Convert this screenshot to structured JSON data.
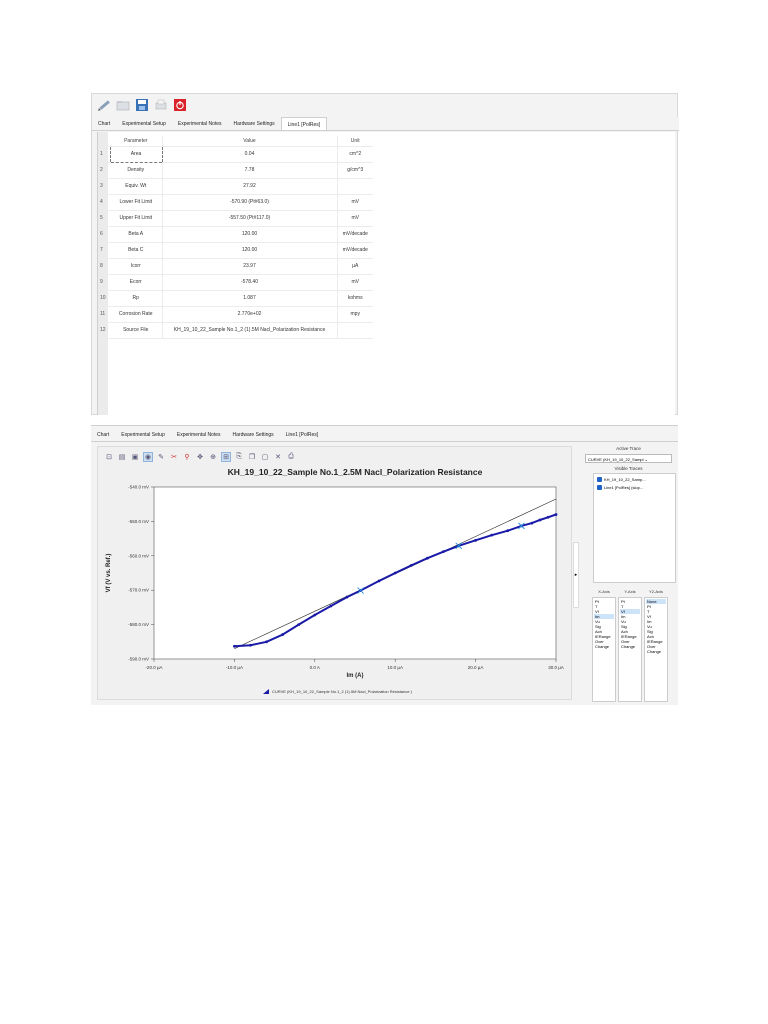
{
  "top": {
    "toolbar_icons": [
      "pencil-icon",
      "folder-icon",
      "save-icon",
      "print-icon",
      "power-icon"
    ],
    "tabs": [
      "Chart",
      "Experimental Setup",
      "Experimental Notes",
      "Hardware Settings",
      "Line1 [PolRes]"
    ],
    "active_tab": 4,
    "table": {
      "headers": [
        "Parameter",
        "Value",
        "Unit"
      ],
      "rows": [
        {
          "num": "1",
          "param": "Area",
          "value": "0.04",
          "unit": "cm^2"
        },
        {
          "num": "2",
          "param": "Density",
          "value": "7.78",
          "unit": "g/cm^3"
        },
        {
          "num": "3",
          "param": "Equiv. Wt",
          "value": "27.92",
          "unit": ""
        },
        {
          "num": "4",
          "param": "Lower Fit Limit",
          "value": "-570.90 (Pt#63.0)",
          "unit": "mV"
        },
        {
          "num": "5",
          "param": "Upper Fit Limit",
          "value": "-557.50 (Pt#117.0)",
          "unit": "mV"
        },
        {
          "num": "6",
          "param": "Beta A",
          "value": "120.00",
          "unit": "mV/decade"
        },
        {
          "num": "7",
          "param": "Beta C",
          "value": "120.00",
          "unit": "mV/decade"
        },
        {
          "num": "8",
          "param": "Icorr",
          "value": "23.97",
          "unit": "µA"
        },
        {
          "num": "9",
          "param": "Ecorr",
          "value": "-578.40",
          "unit": "mV"
        },
        {
          "num": "10",
          "param": "Rp",
          "value": "1.087",
          "unit": "kohms"
        },
        {
          "num": "11",
          "param": "Corrosion Rate",
          "value": "2.770e+02",
          "unit": "mpy"
        },
        {
          "num": "12",
          "param": "Source File",
          "value": "KH_19_10_22_Sample No.1_2 (1).5M Nacl_Polarization Resistance",
          "unit": ""
        }
      ]
    }
  },
  "bottom": {
    "tabs": [
      "Chart",
      "Experimental Setup",
      "Experimental Notes",
      "Hardware Settings",
      "Line1 [PolRes]"
    ],
    "chart_toolbar_icons": [
      "zoom-fit-icon",
      "chart-icon",
      "image-icon",
      "cursor-icon",
      "marker-icon",
      "cut-icon",
      "search-cut-icon",
      "pan-icon",
      "zoom-in-icon",
      "zoom-box-icon",
      "export-icon",
      "copy-icon",
      "window-icon",
      "delete-icon",
      "print-icon"
    ],
    "legend_text": "CURVE (KH_19_10_22_Sample No.1_2 (1).5M Nacl_Polarization Resistance )",
    "side": {
      "active_trace_title": "Active Trace",
      "active_trace_value": "CURVE (KH_19_10_22_Sampl",
      "visible_traces_title": "Visible Traces",
      "visible_traces": [
        "KH_19_10_22_Samp...",
        "Line1 [PolRes] (slop..."
      ],
      "axes": [
        {
          "header": "X-Axis",
          "items": [
            "Pt",
            "T",
            "Vf",
            "Im",
            "Vu",
            "Sig",
            "Ach",
            "IERange",
            "Over",
            "Change"
          ],
          "selected": 3
        },
        {
          "header": "Y-Axis",
          "items": [
            "Pt",
            "T",
            "Vf",
            "Im",
            "Vu",
            "Sig",
            "Ach",
            "IERange",
            "Over",
            "Change"
          ],
          "selected": 2
        },
        {
          "header": "Y2-Axis",
          "items": [
            "None",
            "Pt",
            "T",
            "Vf",
            "Im",
            "Vu",
            "Sig",
            "Ach",
            "IERange",
            "Over",
            "Change"
          ],
          "selected": 0
        }
      ]
    }
  },
  "chart_data": {
    "type": "scatter",
    "title": "KH_19_10_22_Sample No.1_2.5M Nacl_Polarization Resistance",
    "xlabel": "Im (A)",
    "ylabel": "Vf (V vs. Ref.)",
    "xlim": [
      -20,
      30
    ],
    "ylim": [
      -590,
      -540
    ],
    "x_ticks": [
      "-20.0 µA",
      "-10.0 µA",
      "0.0 A",
      "10.0 µA",
      "20.0 µA",
      "30.0 µA"
    ],
    "y_ticks": [
      "-540.0 mV",
      "-550.0 mV",
      "-560.0 mV",
      "-570.0 mV",
      "-580.0 mV",
      "-590.0 mV"
    ],
    "x_unit": "µA",
    "y_unit": "mV",
    "series": [
      {
        "color": "#1a1aa8",
        "x": [
          -10.0,
          -8.0,
          -6.0,
          -4.0,
          -2.0,
          0.0,
          2.0,
          4.0,
          5.7,
          8.0,
          10.0,
          12.0,
          14.0,
          16.0,
          17.9,
          20.0,
          22.0,
          24.0,
          25.7,
          27.0,
          28.0,
          29.0,
          30.0
        ],
        "y": [
          -586.3,
          -586.0,
          -585.0,
          -582.9,
          -580.0,
          -577.2,
          -574.6,
          -572.0,
          -570.1,
          -567.3,
          -565.0,
          -562.8,
          -560.7,
          -558.8,
          -557.1,
          -555.5,
          -554.0,
          -552.7,
          -551.3,
          -550.5,
          -549.6,
          -548.8,
          -548.0
        ]
      },
      {
        "color": "#222222",
        "x": [
          -10.0,
          30.0
        ],
        "y": [
          -587.0,
          -543.5
        ]
      }
    ],
    "fit_markers": [
      {
        "x": 5.7,
        "y": -570.1
      },
      {
        "x": 17.9,
        "y": -557.1
      },
      {
        "x": 25.7,
        "y": -551.3
      }
    ],
    "grid": false
  }
}
